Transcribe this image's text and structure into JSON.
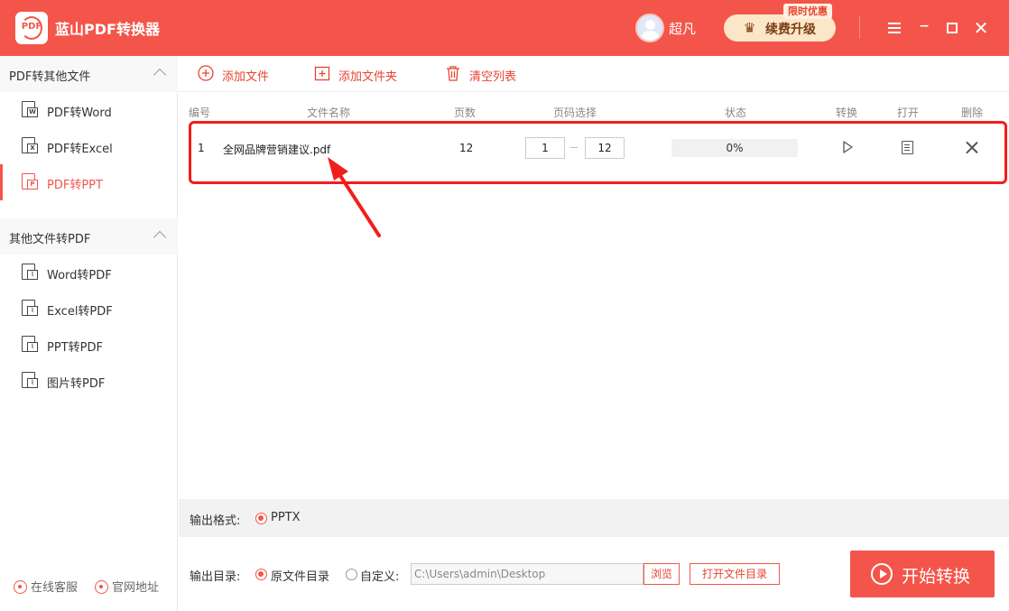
{
  "app": {
    "logo_text": "PDF",
    "title": "蓝山PDF转换器",
    "username": "超凡",
    "upgrade_label": "续费升级",
    "promo_badge": "限时优惠",
    "accent_color": "#f4554a"
  },
  "sidebar": {
    "groups": [
      {
        "label": "PDF转其他文件",
        "items": [
          {
            "label": "PDF转Word",
            "icon": "word-doc-icon",
            "tag": "W",
            "active": false
          },
          {
            "label": "PDF转Excel",
            "icon": "excel-doc-icon",
            "tag": "X",
            "active": false
          },
          {
            "label": "PDF转PPT",
            "icon": "ppt-doc-icon",
            "tag": "P",
            "active": true
          }
        ]
      },
      {
        "label": "其他文件转PDF",
        "items": [
          {
            "label": "Word转PDF",
            "icon": "pdf-doc-icon",
            "tag": "",
            "active": false
          },
          {
            "label": "Excel转PDF",
            "icon": "pdf-doc-icon",
            "tag": "",
            "active": false
          },
          {
            "label": "PPT转PDF",
            "icon": "pdf-doc-icon",
            "tag": "",
            "active": false
          },
          {
            "label": "图片转PDF",
            "icon": "pdf-doc-icon",
            "tag": "",
            "active": false
          }
        ]
      }
    ],
    "footer": {
      "support_label": "在线客服",
      "website_label": "官网地址"
    }
  },
  "toolbar": {
    "add_file": "添加文件",
    "add_folder": "添加文件夹",
    "clear_list": "清空列表"
  },
  "table": {
    "columns": {
      "index": "编号",
      "filename": "文件名称",
      "pages": "页数",
      "page_range": "页码选择",
      "status": "状态",
      "convert": "转换",
      "open": "打开",
      "delete": "删除"
    },
    "rows": [
      {
        "index": "1",
        "filename": "全网品牌营销建议.pdf",
        "pages": "12",
        "range_from": "1",
        "range_to": "12",
        "progress_label": "0%",
        "progress": 0
      }
    ]
  },
  "output": {
    "format_label": "输出格式:",
    "format_value": "PPTX",
    "dir_label": "输出目录:",
    "dir_original": "原文件目录",
    "dir_custom": "自定义:",
    "dir_path": "C:\\Users\\admin\\Desktop",
    "browse": "浏览",
    "open_dir": "打开文件目录",
    "start": "开始转换"
  }
}
